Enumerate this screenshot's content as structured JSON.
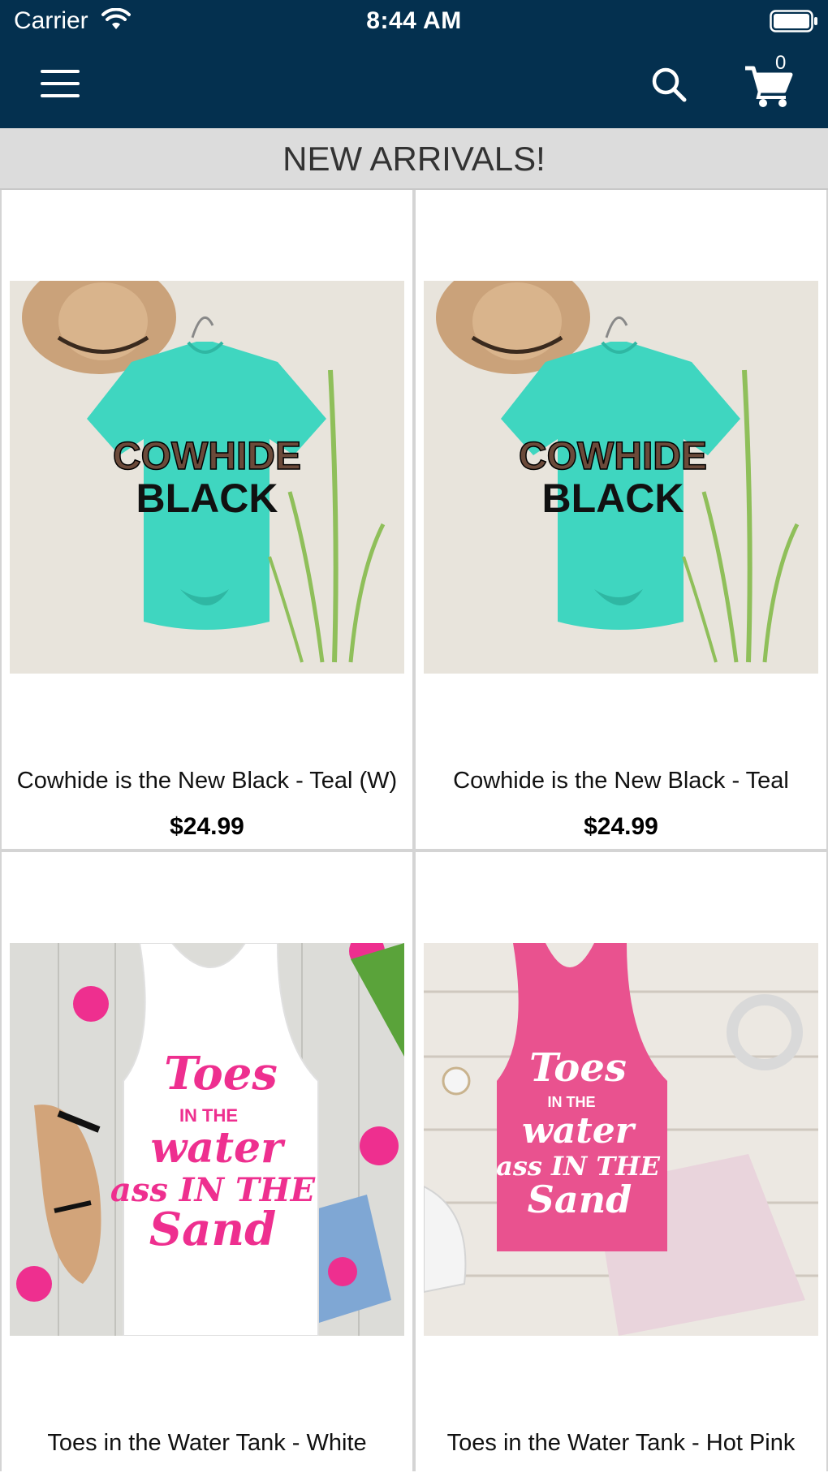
{
  "status_bar": {
    "carrier": "Carrier",
    "time": "8:44 AM"
  },
  "nav": {
    "menu_icon": "hamburger-menu-icon",
    "search_icon": "search-icon",
    "cart_icon": "cart-icon",
    "cart_count": "0",
    "bar_color": "#04304f"
  },
  "section": {
    "title": "NEW ARRIVALS!"
  },
  "products": [
    {
      "name": "Cowhide is the New Black - Teal (W)",
      "price": "$24.99",
      "shirt_color": "#3fd6c0",
      "print_text_top": "COWHIDE",
      "print_text_bottom": "BLACK"
    },
    {
      "name": "Cowhide is the New Black - Teal",
      "price": "$24.99",
      "shirt_color": "#3fd6c0",
      "print_text_top": "COWHIDE",
      "print_text_bottom": "BLACK"
    },
    {
      "name": "Toes in the Water Tank - White",
      "shirt_color": "#ffffff",
      "print_color": "#ee2f8f",
      "print_lines": [
        "Toes",
        "IN THE",
        "water",
        "ass IN THE",
        "Sand"
      ]
    },
    {
      "name": "Toes in the Water Tank - Hot Pink",
      "shirt_color": "#e9528f",
      "print_color": "#ffffff",
      "print_lines": [
        "Toes",
        "IN THE",
        "water",
        "ass IN THE",
        "Sand"
      ]
    }
  ]
}
